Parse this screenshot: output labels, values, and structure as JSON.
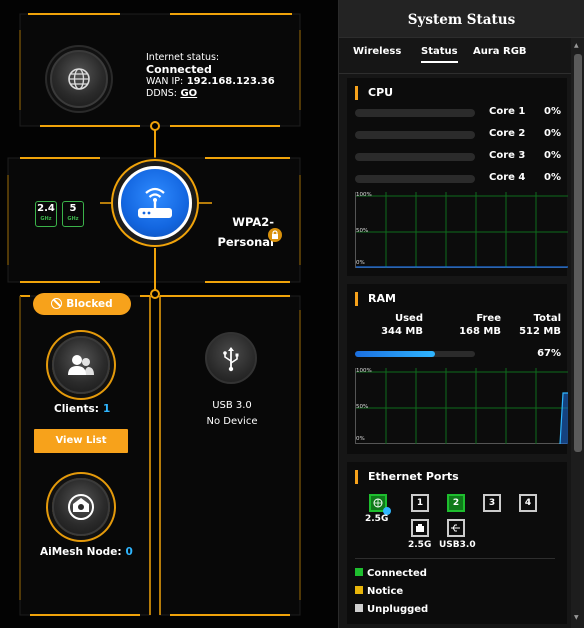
{
  "internet": {
    "status_label": "Internet status:",
    "status_value": "Connected",
    "wan_label": "WAN IP:",
    "wan_ip": "192.168.123.36",
    "ddns_label": "DDNS:",
    "ddns_link": "GO"
  },
  "wireless": {
    "band_24": "2.4",
    "band_24_unit": "GHz",
    "band_5": "5",
    "band_5_unit": "GHz",
    "security_line1": "WPA2-",
    "security_line2": "Personal"
  },
  "clients": {
    "blocked_label": "Blocked",
    "label": "Clients:",
    "count": "1",
    "view_list": "View List"
  },
  "aimesh": {
    "label": "AiMesh Node:",
    "count": "0"
  },
  "usb": {
    "name": "USB 3.0",
    "status": "No Device"
  },
  "panel": {
    "title": "System Status",
    "tabs": [
      "Wireless",
      "Status",
      "Aura RGB"
    ],
    "active_tab": "Status"
  },
  "cpu": {
    "title": "CPU",
    "cores": [
      {
        "name": "Core 1",
        "pct": "0%"
      },
      {
        "name": "Core 2",
        "pct": "0%"
      },
      {
        "name": "Core 3",
        "pct": "0%"
      },
      {
        "name": "Core 4",
        "pct": "0%"
      }
    ],
    "graph_labels": [
      "100%",
      "50%",
      "0%"
    ]
  },
  "ram": {
    "title": "RAM",
    "used_label": "Used",
    "used": "344 MB",
    "free_label": "Free",
    "free": "168 MB",
    "total_label": "Total",
    "total": "512 MB",
    "usage_pct": "67%",
    "usage_fraction": 0.67,
    "graph_labels": [
      "100%",
      "50%",
      "0%"
    ]
  },
  "ethernet": {
    "title": "Ethernet Ports",
    "wan_port_label": "2.5G",
    "lan_ports": [
      "1",
      "2",
      "3",
      "4"
    ],
    "lan25_label": "2.5G",
    "usb_label": "USB3.0"
  },
  "legend": {
    "connected": "Connected",
    "notice": "Notice",
    "unplugged": "Unplugged"
  },
  "colors": {
    "accent": "#f7a21b",
    "connected": "#1ebe2e",
    "notice": "#e8b50a",
    "unplugged": "#cfcfcf",
    "link_blue": "#2fb6ff"
  }
}
